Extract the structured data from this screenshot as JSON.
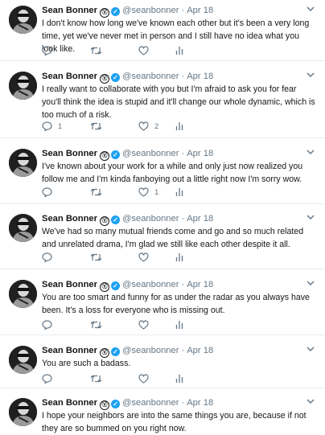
{
  "author": {
    "name": "Sean Bonner",
    "badge": "Ⓥ",
    "verified_mark": "✓",
    "handle": "@seanbonner",
    "separator": "·"
  },
  "tweets": [
    {
      "date": "Apr 18",
      "text": "I don't know how long we've known each other but it's been a very long time, yet we've never met in person and I still have no idea what you look like.",
      "reply_count": "",
      "retweet_count": "",
      "like_count": ""
    },
    {
      "date": "Apr 18",
      "text": "I really want to collaborate with you but I'm afraid to ask you for fear you'll think the idea is stupid and it'll change our whole dynamic, which is too much of a risk.",
      "reply_count": "1",
      "retweet_count": "",
      "like_count": "2"
    },
    {
      "date": "Apr 18",
      "text": "I've known about your work for a while and only just now realized you follow me and I'm kinda fanboying out a little right now I'm sorry wow.",
      "reply_count": "",
      "retweet_count": "",
      "like_count": "1"
    },
    {
      "date": "Apr 18",
      "text": "We've had so many mutual friends come and go and so much related and unrelated drama, I'm glad we still like each other despite it all.",
      "reply_count": "",
      "retweet_count": "",
      "like_count": ""
    },
    {
      "date": "Apr 18",
      "text": "You are too smart and funny for as under the radar as you always have been. It's a loss for everyone who is missing out.",
      "reply_count": "",
      "retweet_count": "",
      "like_count": ""
    },
    {
      "date": "Apr 18",
      "text": "You are such a badass.",
      "reply_count": "",
      "retweet_count": "",
      "like_count": ""
    },
    {
      "date": "Apr 18",
      "text": "I hope your neighbors are into the same things you are, because if not they are so bummed on you right now.",
      "reply_count": "",
      "retweet_count": "",
      "like_count": ""
    }
  ],
  "colors": {
    "text": "#14171a",
    "secondary": "#657786",
    "verified": "#1da1f2",
    "divider": "#e6ecf0"
  },
  "icons": [
    "reply-icon",
    "retweet-icon",
    "like-icon",
    "analytics-icon",
    "chevron-down-icon",
    "verified-icon"
  ]
}
